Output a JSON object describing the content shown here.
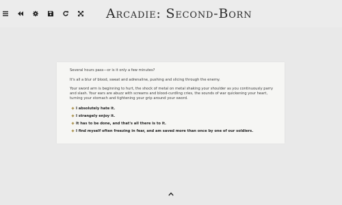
{
  "header": {
    "title": "Arcadie: Second-Born"
  },
  "toolbar": {
    "buttons": [
      {
        "name": "menu-icon"
      },
      {
        "name": "rewind-icon"
      },
      {
        "name": "gear-icon"
      },
      {
        "name": "save-icon"
      },
      {
        "name": "refresh-icon"
      },
      {
        "name": "fullscreen-icon"
      }
    ]
  },
  "story": {
    "paragraphs": [
      "Several hours pass—or is it only a few minutes?",
      "It's all a blur of blood, sweat and adrenaline, pushing and slicing through the enemy.",
      "Your sword arm is beginning to hurt, the shock of metal on metal shaking your shoulder as you continuously parry and slash. Your ears are abuzz with screams and blood-curdling cries, the sounds of war quickening your heart, turning your stomach and tightening your grip around your sword."
    ],
    "choices": [
      "I absolutely hate it.",
      "I strangely enjoy it.",
      "It has to be done, and that's all there is to it.",
      "I find myself often freezing in fear, and am saved more than once by one of our soldiers."
    ]
  },
  "colors": {
    "background": "#e9e9e9",
    "panel": "#f6f6f4",
    "bullet": "#b09a5c",
    "text": "#3a3a3a"
  }
}
